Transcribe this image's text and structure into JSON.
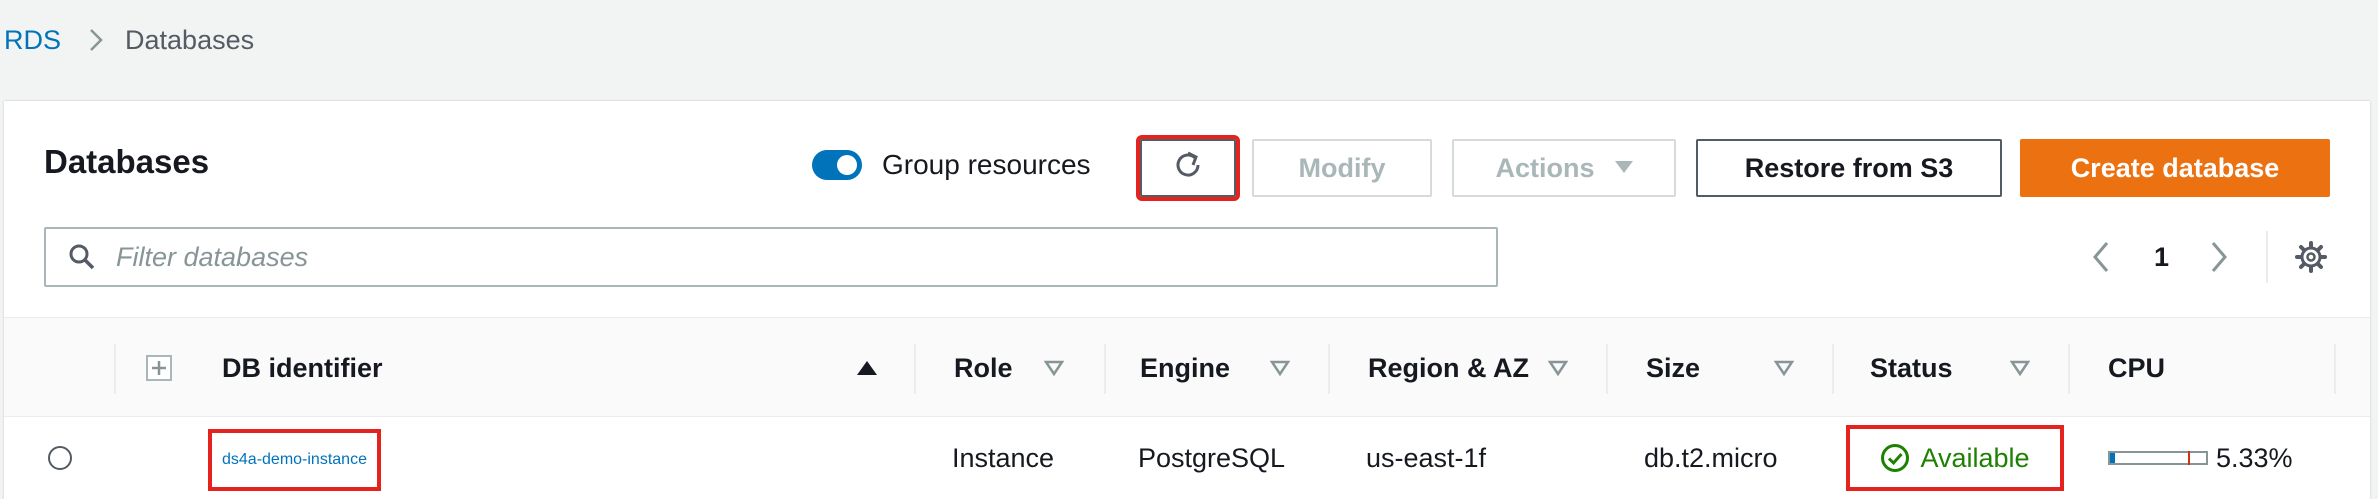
{
  "breadcrumb": {
    "root": "RDS",
    "current": "Databases"
  },
  "panel": {
    "title": "Databases",
    "group_resources_label": "Group resources",
    "group_resources_on": true
  },
  "toolbar": {
    "refresh_icon": "refresh-icon",
    "modify_label": "Modify",
    "actions_label": "Actions",
    "restore_label": "Restore from S3",
    "create_label": "Create database"
  },
  "search": {
    "placeholder": "Filter databases",
    "value": ""
  },
  "pagination": {
    "page": "1"
  },
  "table": {
    "columns": [
      "DB identifier",
      "Role",
      "Engine",
      "Region & AZ",
      "Size",
      "Status",
      "CPU"
    ],
    "rows": [
      {
        "db_identifier": "ds4a-demo-instance",
        "role": "Instance",
        "engine": "PostgreSQL",
        "region_az": "us-east-1f",
        "size": "db.t2.micro",
        "status": "Available",
        "cpu": "5.33%",
        "cpu_fraction": 0.0533
      }
    ]
  },
  "colors": {
    "link": "#0073bb",
    "primary": "#ec7211",
    "status_available": "#1d8102",
    "highlight": "#e4221e"
  }
}
